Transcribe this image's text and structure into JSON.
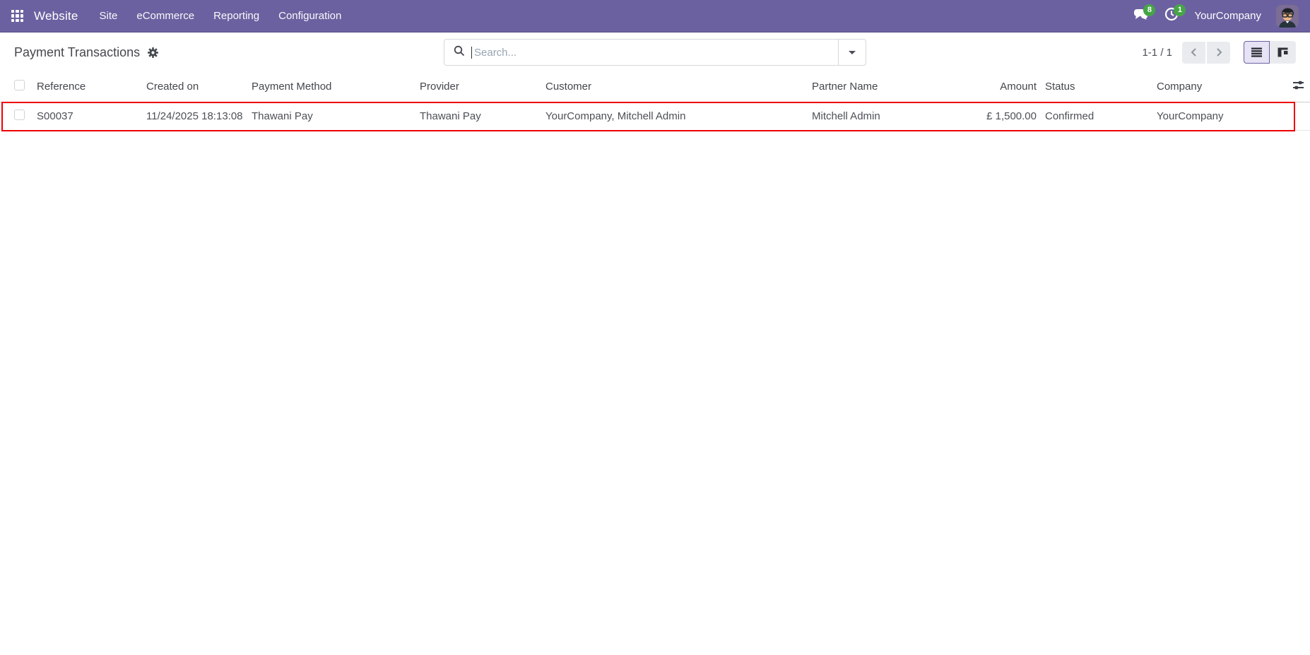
{
  "navbar": {
    "app_name": "Website",
    "menus": [
      "Site",
      "eCommerce",
      "Reporting",
      "Configuration"
    ],
    "messages_badge": "8",
    "activities_badge": "1",
    "company_name": "YourCompany"
  },
  "control_panel": {
    "title": "Payment Transactions",
    "search": {
      "placeholder": "Search..."
    },
    "pager": {
      "text": "1-1 / 1"
    }
  },
  "table": {
    "headers": [
      "Reference",
      "Created on",
      "Payment Method",
      "Provider",
      "Customer",
      "Partner Name",
      "Amount",
      "Status",
      "Company"
    ],
    "row": {
      "reference": "S00037",
      "created_on": "11/24/2025 18:13:08",
      "payment_method": "Thawani Pay",
      "provider": "Thawani Pay",
      "customer": "YourCompany, Mitchell Admin",
      "partner_name": "Mitchell Admin",
      "amount": "£ 1,500.00",
      "status": "Confirmed",
      "company": "YourCompany"
    }
  },
  "colors": {
    "navbar_bg": "#6c61a0",
    "badge_green": "#46a546",
    "highlight_red": "#ee0000",
    "active_view_bg": "#e7e2f4"
  }
}
